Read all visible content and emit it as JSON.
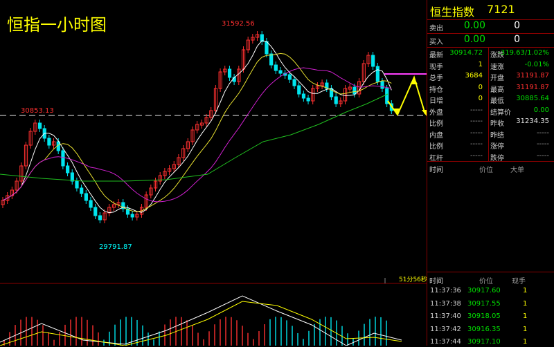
{
  "chart": {
    "title": "恒指一小时图",
    "high_label": "31592.56",
    "low_label": "29791.87",
    "left_high_label": "30853.13",
    "timer": "51分56秒"
  },
  "panel": {
    "name": "恒生指数",
    "code": "7121",
    "sell": {
      "label": "卖出",
      "price": "0.00",
      "qty": "0"
    },
    "buy": {
      "label": "买入",
      "price": "0.00",
      "qty": "0"
    },
    "stats": [
      {
        "l1": "最新",
        "v1": "30914.72",
        "l2": "涨跌",
        "v2": "-319.63/1.02%"
      },
      {
        "l1": "现手",
        "v1": "1",
        "l2": "速涨",
        "v2": "-0.01%"
      },
      {
        "l1": "总手",
        "v1": "3684",
        "l2": "开盘",
        "v2": "31191.87"
      },
      {
        "l1": "持仓",
        "v1": "0",
        "l2": "最高",
        "v2": "31191.87"
      },
      {
        "l1": "日增",
        "v1": "0",
        "l2": "最低",
        "v2": "30885.64"
      },
      {
        "l1": "外盘",
        "v1": "-----",
        "l2": "结算价",
        "v2": "0.00"
      },
      {
        "l1": "比例",
        "v1": "-----",
        "l2": "昨收",
        "v2": "31234.35"
      },
      {
        "l1": "内盘",
        "v1": "-----",
        "l2": "昨结",
        "v2": "-----"
      },
      {
        "l1": "比例",
        "v1": "-----",
        "l2": "涨停",
        "v2": "-----"
      },
      {
        "l1": "杠杆",
        "v1": "-----",
        "l2": "跌停",
        "v2": "-----"
      }
    ],
    "trade_header_top": {
      "time": "时间",
      "price": "价位",
      "vol": "大单"
    },
    "trade_header_bottom": {
      "time": "时间",
      "price": "价位",
      "vol": "现手"
    },
    "ticks": [
      {
        "time": "11:37:36",
        "price": "30917.60",
        "vol": "1"
      },
      {
        "time": "11:37:38",
        "price": "30917.55",
        "vol": "1"
      },
      {
        "time": "11:37:40",
        "price": "30918.05",
        "vol": "1"
      },
      {
        "time": "11:37:42",
        "price": "30916.35",
        "vol": "1"
      },
      {
        "time": "11:37:44",
        "price": "30917.10",
        "vol": "1"
      }
    ]
  },
  "colors": {
    "up": "#ff3030",
    "down": "#00e5ee",
    "ma5": "#ffffff",
    "ma10": "#e8e030",
    "ma20": "#d020d0",
    "ma60": "#20c020"
  }
}
